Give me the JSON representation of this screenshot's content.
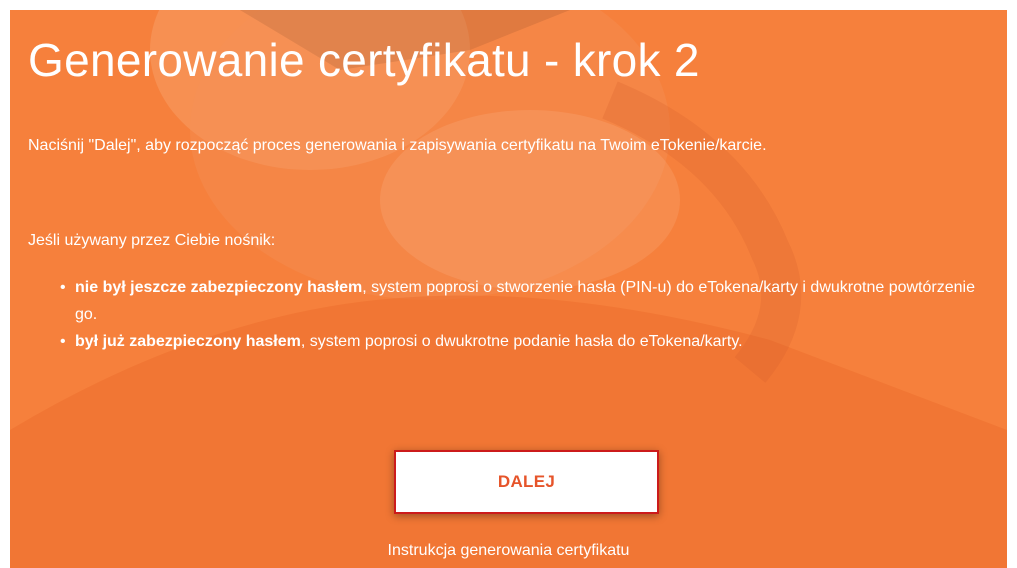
{
  "page": {
    "title": "Generowanie certyfikatu - krok 2",
    "intro": "Naciśnij \"Dalej\", aby rozpocząć proces generowania i zapisywania certyfikatu na Twoim eTokenie/karcie.",
    "lead": "Jeśli używany przez Ciebie nośnik:",
    "bullets": [
      {
        "bold": "nie był jeszcze zabezpieczony hasłem",
        "rest": ", system poprosi o stworzenie hasła (PIN-u) do eTokena/karty i dwukrotne powtórzenie go."
      },
      {
        "bold": "był już zabezpieczony hasłem",
        "rest": ", system poprosi o dwukrotne podanie hasła do eTokena/karty."
      }
    ],
    "next_button": "DALEJ",
    "instruction_link": "Instrukcja generowania certyfikatu"
  },
  "colors": {
    "background": "#f6803c",
    "button_text": "#e6542a",
    "button_border": "#cc1b1b"
  }
}
